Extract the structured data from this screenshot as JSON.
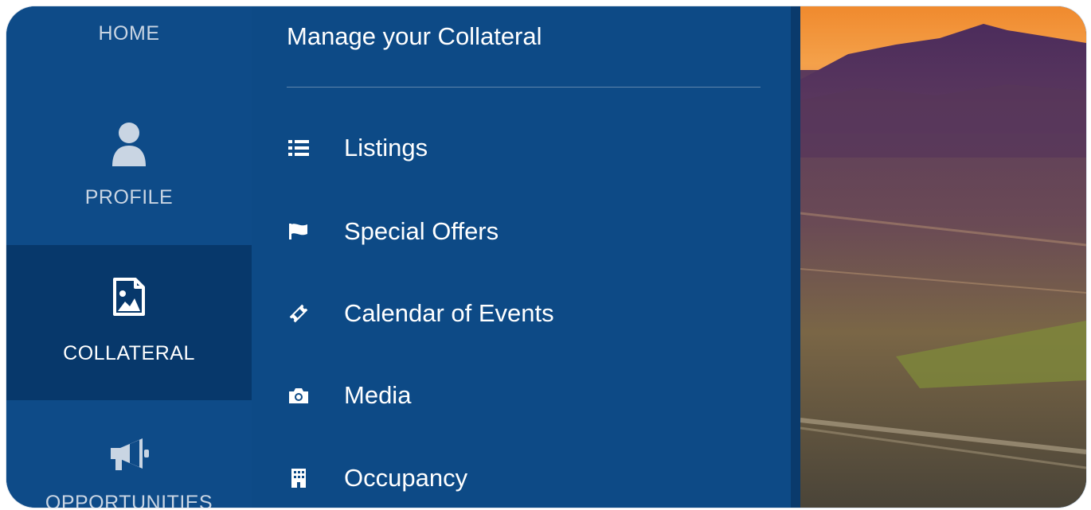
{
  "rail": {
    "items": [
      {
        "label": "HOME",
        "icon": "home"
      },
      {
        "label": "PROFILE",
        "icon": "user-icon"
      },
      {
        "label": "COLLATERAL",
        "icon": "image-file-icon",
        "active": true
      },
      {
        "label": "OPPORTUNITIES",
        "icon": "megaphone-icon"
      }
    ]
  },
  "panel": {
    "title": "Manage your Collateral",
    "items": [
      {
        "label": "Listings",
        "icon": "list-icon"
      },
      {
        "label": "Special Offers",
        "icon": "flag-icon"
      },
      {
        "label": "Calendar of Events",
        "icon": "ticket-icon"
      },
      {
        "label": "Media",
        "icon": "camera-icon"
      },
      {
        "label": "Occupancy",
        "icon": "building-icon"
      }
    ]
  },
  "colors": {
    "rail_bg": "#0e4b88",
    "rail_active": "#07386b",
    "panel_bg": "#0d4a86",
    "text": "#ffffff",
    "muted_text": "#c9d5e3"
  }
}
